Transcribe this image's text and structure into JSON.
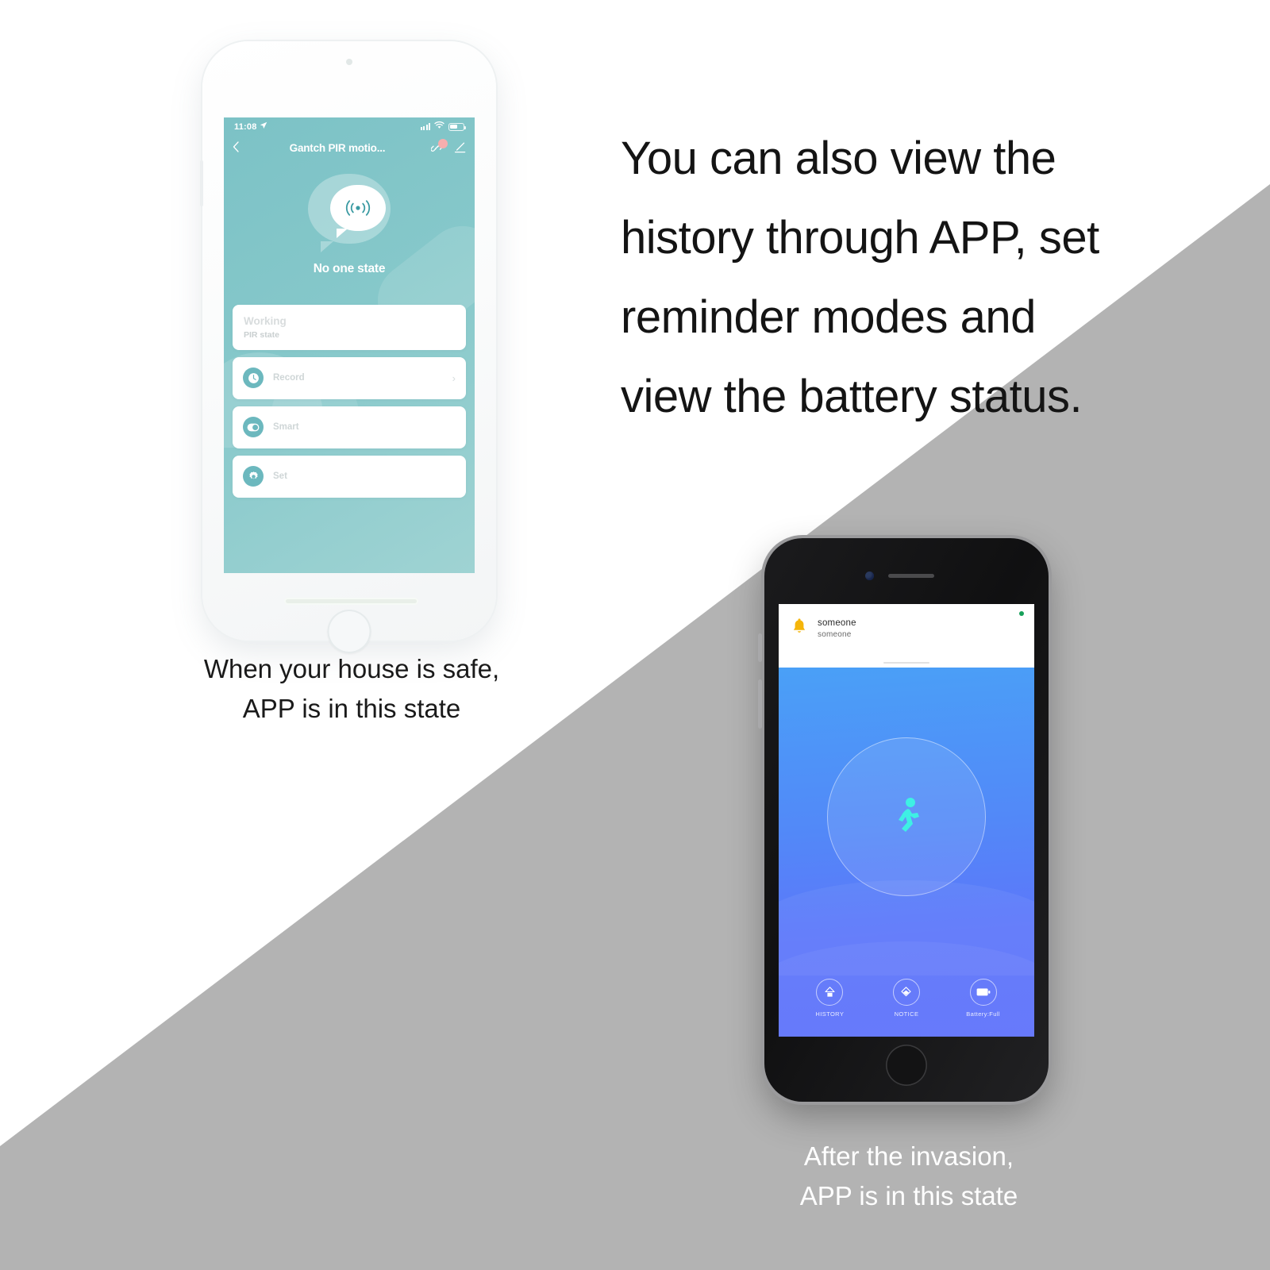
{
  "headline": {
    "lines": [
      "You can also view the",
      "history through APP, set",
      "reminder modes and",
      "view the battery status."
    ]
  },
  "phone_safe": {
    "caption_lines": [
      "When your house is safe,",
      "APP is in this state"
    ],
    "status_bar": {
      "time": "11:08",
      "location_arrow": "➤",
      "signal_icon": "signal-bars-icon",
      "wifi_icon": "wifi-icon",
      "battery_icon": "battery-icon"
    },
    "app_bar": {
      "back_icon": "chevron-left-icon",
      "title": "Gantch PIR motio...",
      "link_icon": "share-link-icon",
      "edit_icon": "pencil-edit-icon"
    },
    "hero": {
      "icon": "motion-signal-icon",
      "label": "No one state"
    },
    "cards": [
      {
        "type": "status",
        "main": "Working",
        "sub": "PIR state"
      },
      {
        "type": "row",
        "icon": "clock-icon",
        "label": "Record",
        "chevron": "›"
      },
      {
        "type": "row",
        "icon": "toggle-icon",
        "label": "Smart",
        "chevron": ""
      },
      {
        "type": "row",
        "icon": "gear-icon",
        "label": "Set",
        "chevron": ""
      }
    ]
  },
  "phone_alarm": {
    "caption_lines": [
      "After the invasion,",
      "APP is in this state"
    ],
    "notification": {
      "icon": "bell-icon",
      "title": "someone",
      "subtitle": "someone",
      "status_dot": "online-dot"
    },
    "hero": {
      "icon": "running-person-icon"
    },
    "buttons": [
      {
        "icon": "history-icon",
        "label": "HISTORY"
      },
      {
        "icon": "notice-icon",
        "label": "NOTICE"
      },
      {
        "icon": "battery-full-icon",
        "label": "Battery:Full"
      }
    ]
  },
  "colors": {
    "teal_top": "#7cc2c6",
    "teal_bottom": "#9fd3d3",
    "blue_top": "#4aa0f7",
    "blue_bottom": "#5f72fb",
    "runner_cyan": "#3ef0e4",
    "badge_pink": "#f6aeae",
    "bell_yellow": "#f5b50a",
    "gray_wedge": "#b3b3b3",
    "icon_teal": "#6cb8be"
  }
}
